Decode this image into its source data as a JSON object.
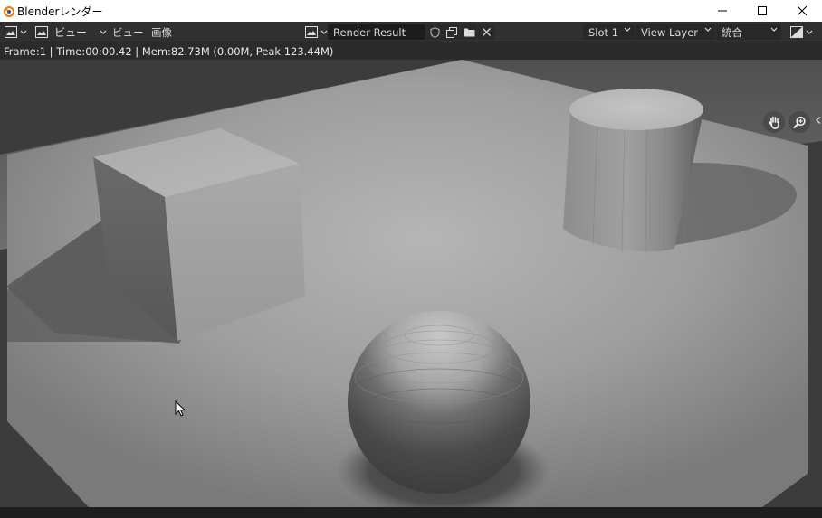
{
  "window": {
    "title": "Blenderレンダー",
    "minimize_icon": "minimize-icon",
    "maximize_icon": "maximize-icon",
    "close_icon": "close-icon"
  },
  "header": {
    "editor_type_icon": "image-editor-icon",
    "view_mode_label": "ビュー",
    "menus": [
      "ビュー",
      "画像"
    ],
    "image_name": "Render Result",
    "slot": "Slot 1",
    "view_layer": "View Layer",
    "pass": "統合",
    "display_channels_icon": "display-channels-icon"
  },
  "info": {
    "status": "Frame:1 | Time:00:00.42 | Mem:82.73M (0.00M, Peak 123.44M)"
  },
  "render": {
    "description_icons": [
      "hand-icon",
      "zoom-icon"
    ]
  }
}
